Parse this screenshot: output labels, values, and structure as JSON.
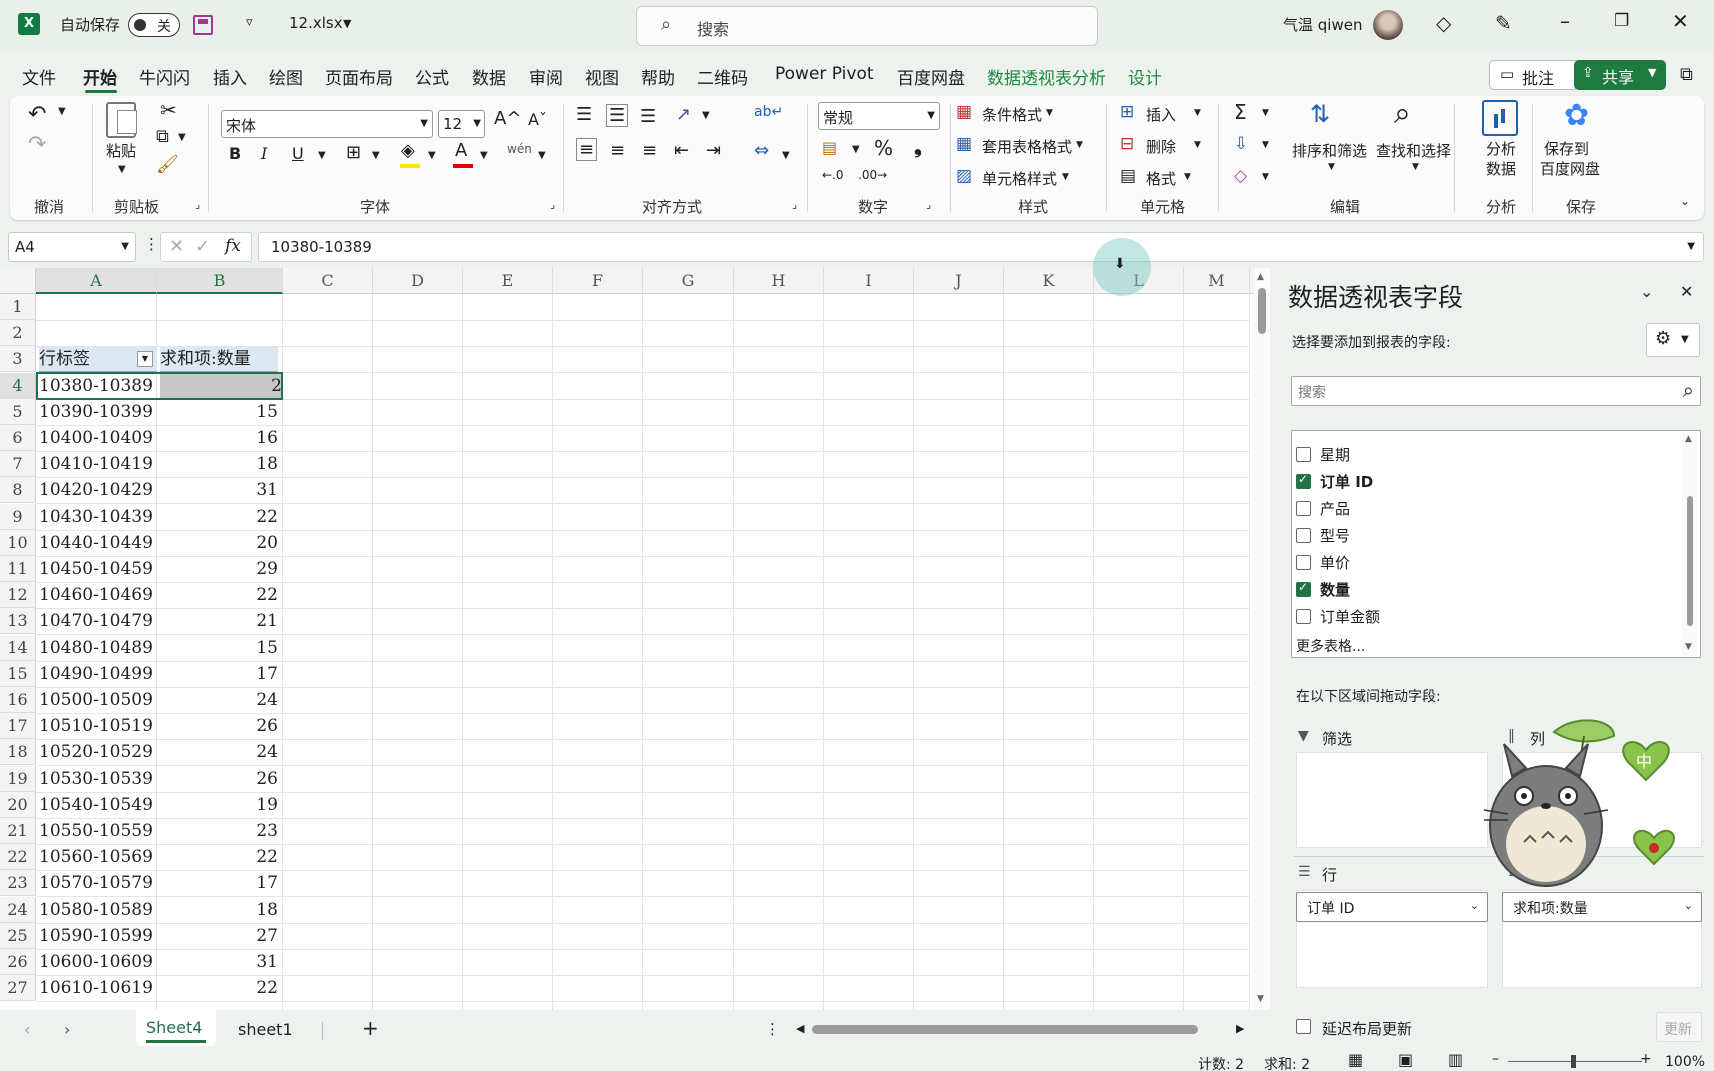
{
  "titlebar": {
    "autosave_label": "自动保存",
    "autosave_state": "关",
    "filename": "12.xlsx",
    "search_placeholder": "搜索",
    "user_name": "气温 qiwen"
  },
  "tabs": [
    "文件",
    "开始",
    "牛闪闪",
    "插入",
    "绘图",
    "页面布局",
    "公式",
    "数据",
    "审阅",
    "视图",
    "帮助",
    "二维码",
    "Power Pivot",
    "百度网盘",
    "数据透视表分析",
    "设计"
  ],
  "active_tab": "开始",
  "actions": {
    "comments": "批注",
    "share": "共享"
  },
  "ribbon": {
    "groups": [
      "撤消",
      "剪贴板",
      "字体",
      "对齐方式",
      "数字",
      "样式",
      "单元格",
      "编辑",
      "分析",
      "保存"
    ],
    "paste": "粘贴",
    "font_name": "宋体",
    "font_size": "12",
    "number_format": "常规",
    "cond_format": "条件格式",
    "table_format": "套用表格格式",
    "cell_style": "单元格样式",
    "insert": "插入",
    "delete": "删除",
    "format": "格式",
    "sort_filter": "排序和筛选",
    "find_select": "查找和选择",
    "analyze_line1": "分析",
    "analyze_line2": "数据",
    "save_line1": "保存到",
    "save_line2": "百度网盘"
  },
  "formula_bar": {
    "name_box": "A4",
    "fx": "fx",
    "value": "10380-10389"
  },
  "columns": [
    "A",
    "B",
    "C",
    "D",
    "E",
    "F",
    "G",
    "H",
    "I",
    "J",
    "K",
    "L",
    "M"
  ],
  "pivot": {
    "header_row_label": "行标签",
    "header_sum": "求和项:数量",
    "rows": [
      [
        "10380-10389",
        "2"
      ],
      [
        "10390-10399",
        "15"
      ],
      [
        "10400-10409",
        "16"
      ],
      [
        "10410-10419",
        "18"
      ],
      [
        "10420-10429",
        "31"
      ],
      [
        "10430-10439",
        "22"
      ],
      [
        "10440-10449",
        "20"
      ],
      [
        "10450-10459",
        "29"
      ],
      [
        "10460-10469",
        "22"
      ],
      [
        "10470-10479",
        "21"
      ],
      [
        "10480-10489",
        "15"
      ],
      [
        "10490-10499",
        "17"
      ],
      [
        "10500-10509",
        "24"
      ],
      [
        "10510-10519",
        "26"
      ],
      [
        "10520-10529",
        "24"
      ],
      [
        "10530-10539",
        "26"
      ],
      [
        "10540-10549",
        "19"
      ],
      [
        "10550-10559",
        "23"
      ],
      [
        "10560-10569",
        "22"
      ],
      [
        "10570-10579",
        "17"
      ],
      [
        "10580-10589",
        "18"
      ],
      [
        "10590-10599",
        "27"
      ],
      [
        "10600-10609",
        "31"
      ],
      [
        "10610-10619",
        "22"
      ]
    ]
  },
  "sheets": [
    "Sheet4",
    "sheet1"
  ],
  "active_sheet": "Sheet4",
  "status": {
    "count": "计数: 2",
    "sum": "求和: 2",
    "zoom": "100%"
  },
  "field_pane": {
    "title": "数据透视表字段",
    "subtitle": "选择要添加到报表的字段:",
    "search_placeholder": "搜索",
    "fields": [
      {
        "name": "星期",
        "checked": false
      },
      {
        "name": "订单 ID",
        "checked": true
      },
      {
        "name": "产品",
        "checked": false
      },
      {
        "name": "型号",
        "checked": false
      },
      {
        "name": "单价",
        "checked": false
      },
      {
        "name": "数量",
        "checked": true
      },
      {
        "name": "订单金额",
        "checked": false
      }
    ],
    "more_tables": "更多表格...",
    "drag_label": "在以下区域间拖动字段:",
    "filter_label": "筛选",
    "columns_label": "列",
    "rows_label": "行",
    "row_item": "订单 ID",
    "value_item": "求和项:数量",
    "defer_label": "延迟布局更新",
    "update_button": "更新"
  },
  "sticker_text": "中",
  "colors": {
    "excel_green": "#217346",
    "pivot_tab_green": "#1e8a3d",
    "selection_gray": "#c8c8c8"
  }
}
